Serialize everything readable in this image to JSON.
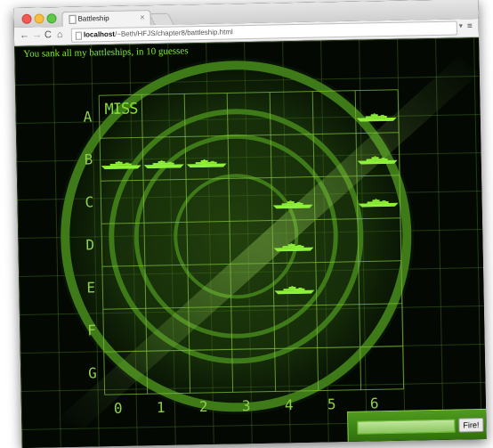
{
  "window": {
    "tab_title": "Battleship",
    "tab_close": "×",
    "url_host": "localhost",
    "url_path": "/~Beth/HFJS/chapter8/battleship.html",
    "nav_back": "←",
    "nav_forward": "→",
    "nav_reload": "C",
    "nav_home": "⌂",
    "menu_glyph": "≡",
    "bookmark_glyph": "▾"
  },
  "game": {
    "message": "You sank all my battleships, in 10 guesses",
    "rows": [
      "A",
      "B",
      "C",
      "D",
      "E",
      "F",
      "G"
    ],
    "columns": [
      "0",
      "1",
      "2",
      "3",
      "4",
      "5",
      "6"
    ],
    "miss_label": "MISS",
    "misses": [
      "A0"
    ],
    "hits": [
      "A6",
      "B0",
      "B1",
      "B2",
      "B6",
      "C4",
      "C6",
      "D4",
      "E4"
    ],
    "guess_placeholder": "",
    "fire_label": "Fire!",
    "colors": {
      "accent": "#7fea32",
      "ship": "#8ff03a",
      "grid": "#7fbf3a",
      "panel": "#3f8a15"
    }
  }
}
